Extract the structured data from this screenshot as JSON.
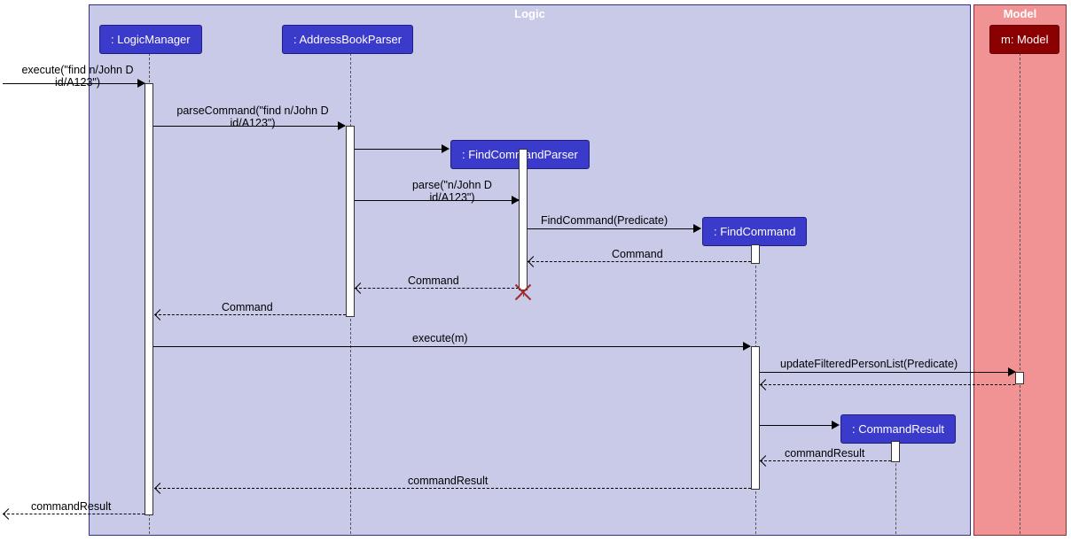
{
  "packages": {
    "logic": "Logic",
    "model": "Model"
  },
  "participants": {
    "logicManager": ": LogicManager",
    "addressBookParser": ": AddressBookParser",
    "findCommandParser": ": FindCommandParser",
    "findCommand": ": FindCommand",
    "commandResult": ": CommandResult",
    "model": "m: Model"
  },
  "messages": {
    "execute_in": "execute(\"find n/John D\nid/A123\")",
    "parseCommand": "parseCommand(\"find n/John D\nid/A123\")",
    "parse": "parse(\"n/John D\nid/A123\")",
    "findCommand_new": "FindCommand(Predicate)",
    "command_ret1": "Command",
    "command_ret2": "Command",
    "command_ret3": "Command",
    "execute_m": "execute(m)",
    "updateFilteredPersonList": "updateFilteredPersonList(Predicate)",
    "commandResult_ret1": "commandResult",
    "commandResult_ret2": "commandResult",
    "commandResult_out": "commandResult"
  }
}
